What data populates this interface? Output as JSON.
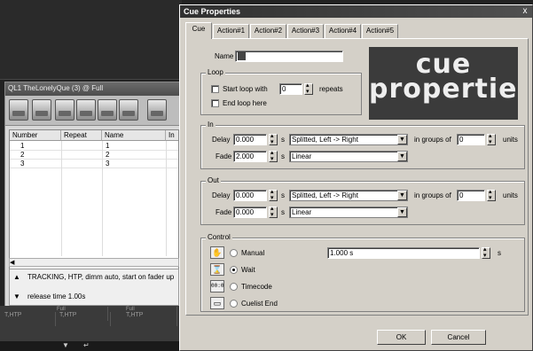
{
  "background_app": {
    "cuelist_title": "QL1  TheLonelyQue (3)  @  Full",
    "columns": [
      "Number",
      "Repeat",
      "Name",
      "In"
    ],
    "rows": [
      {
        "number": "1",
        "name": "1"
      },
      {
        "number": "2",
        "name": "2"
      },
      {
        "number": "3",
        "name": "3"
      }
    ],
    "status_text": "TRACKING, HTP, dimm auto, start on fader up",
    "release_text": "release time 1.00s",
    "strip_cells": [
      "T,HTP",
      "T,HTP",
      "T,HTP"
    ],
    "strip_sublabels": [
      "Full",
      "Full"
    ]
  },
  "dialog": {
    "title": "Cue Properties",
    "close_label": "x",
    "tabs": [
      "Cue",
      "Action#1",
      "Action#2",
      "Action#3",
      "Action#4",
      "Action#5"
    ],
    "logo": {
      "line1": "cue",
      "line2": "properties"
    },
    "name": {
      "label": "Name",
      "value": ""
    },
    "loop": {
      "group_label": "Loop",
      "start_loop_label": "Start loop with",
      "start_loop_value": "0",
      "repeats_label": "repeats",
      "end_loop_label": "End loop here"
    },
    "in": {
      "group_label": "In",
      "delay_label": "Delay",
      "delay_value": "0.000",
      "delay_unit": "s",
      "delay_mode": "Splitted, Left -> Right",
      "groups_label": "in groups of",
      "groups_value": "0",
      "units_label": "units",
      "fade_label": "Fade",
      "fade_value": "2.000",
      "fade_unit": "s",
      "fade_mode": "Linear"
    },
    "out": {
      "group_label": "Out",
      "delay_label": "Delay",
      "delay_value": "0.000",
      "delay_unit": "s",
      "delay_mode": "Splitted, Left -> Right",
      "groups_label": "in groups of",
      "groups_value": "0",
      "units_label": "units",
      "fade_label": "Fade",
      "fade_value": "0.000",
      "fade_unit": "s",
      "fade_mode": "Linear"
    },
    "control": {
      "group_label": "Control",
      "manual_label": "Manual",
      "manual_time": "1.000 s",
      "manual_unit": "s",
      "wait_label": "Wait",
      "timecode_label": "Timecode",
      "timecode_icon": "00:0",
      "cuelist_end_label": "Cuelist End",
      "selected": "Wait"
    },
    "ok_label": "OK",
    "cancel_label": "Cancel"
  }
}
